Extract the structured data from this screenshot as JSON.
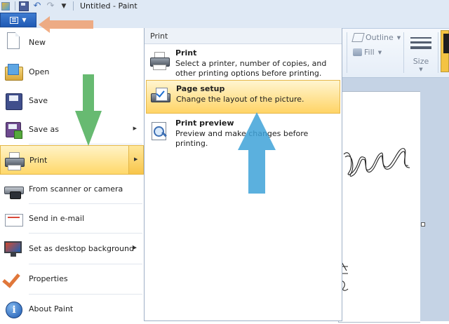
{
  "window": {
    "title": "Untitled - Paint"
  },
  "quick_access": {
    "items": [
      "app-icon",
      "save-icon",
      "undo-icon",
      "redo-icon",
      "customize-dropdown-icon"
    ]
  },
  "app_menu": {
    "items": [
      {
        "label": "New",
        "icon": "new-document-icon",
        "has_submenu": false
      },
      {
        "label": "Open",
        "icon": "open-folder-icon",
        "has_submenu": false
      },
      {
        "label": "Save",
        "icon": "save-disk-icon",
        "has_submenu": false
      },
      {
        "label": "Save as",
        "icon": "save-as-icon",
        "has_submenu": true
      },
      {
        "label": "Print",
        "icon": "printer-icon",
        "has_submenu": true,
        "selected": true
      },
      {
        "label": "From scanner or camera",
        "icon": "scanner-icon",
        "has_submenu": false
      },
      {
        "label": "Send in e-mail",
        "icon": "email-icon",
        "has_submenu": false
      },
      {
        "label": "Set as desktop background",
        "icon": "desktop-icon",
        "has_submenu": true
      },
      {
        "label": "Properties",
        "icon": "properties-check-icon",
        "has_submenu": false
      },
      {
        "label": "About Paint",
        "icon": "info-icon",
        "has_submenu": false
      }
    ]
  },
  "print_submenu": {
    "header": "Print",
    "items": [
      {
        "title": "Print",
        "description": "Select a printer, number of copies, and other printing options before printing."
      },
      {
        "title": "Page setup",
        "description": "Change the layout of the picture.",
        "highlighted": true
      },
      {
        "title": "Print preview",
        "description": "Preview and make changes before printing."
      }
    ]
  },
  "ribbon": {
    "outline_label": "Outline",
    "fill_label": "Fill",
    "size_label": "Size"
  },
  "colors": {
    "menu_highlight": "#ffd86a",
    "app_button": "#1f59b4",
    "arrow_orange": "#f0a070",
    "arrow_green": "#4cae58",
    "arrow_blue": "#3ea2d8"
  }
}
